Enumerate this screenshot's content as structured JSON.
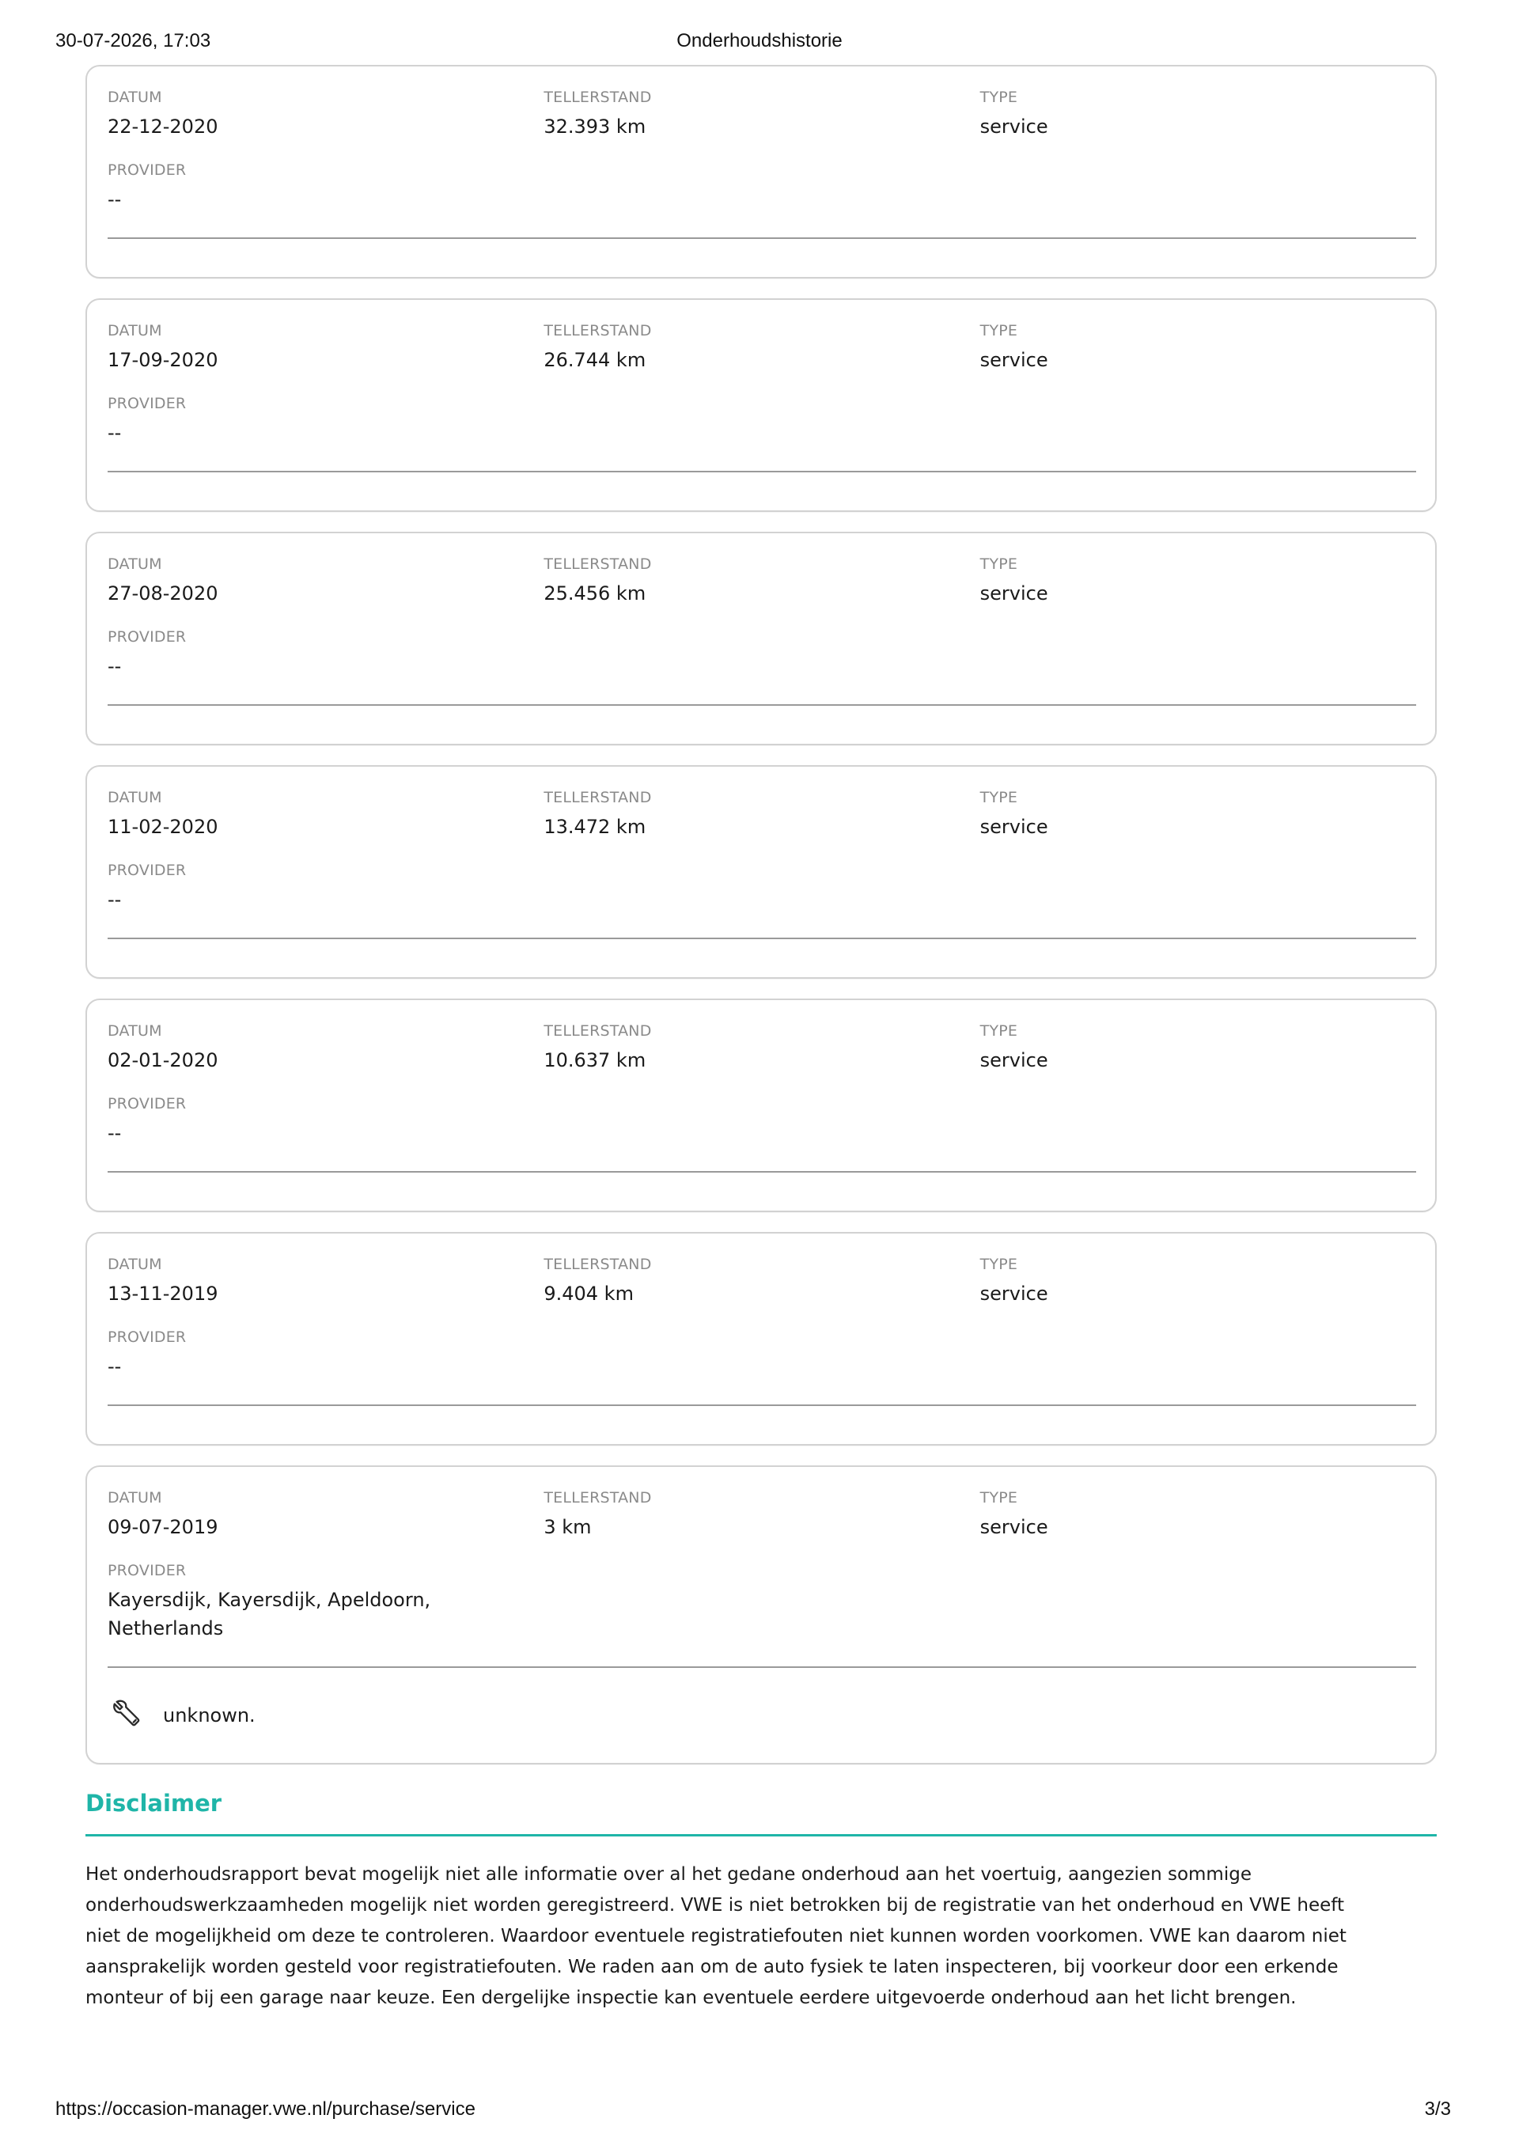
{
  "print_header": {
    "timestamp": "30-07-2026, 17:03",
    "title": "Onderhoudshistorie"
  },
  "labels": {
    "datum": "DATUM",
    "tellerstand": "TELLERSTAND",
    "type": "TYPE",
    "provider": "PROVIDER"
  },
  "records": [
    {
      "datum": "22-12-2020",
      "tellerstand": "32.393 km",
      "type": "service",
      "provider": "--"
    },
    {
      "datum": "17-09-2020",
      "tellerstand": "26.744 km",
      "type": "service",
      "provider": "--"
    },
    {
      "datum": "27-08-2020",
      "tellerstand": "25.456 km",
      "type": "service",
      "provider": "--"
    },
    {
      "datum": "11-02-2020",
      "tellerstand": "13.472 km",
      "type": "service",
      "provider": "--"
    },
    {
      "datum": "02-01-2020",
      "tellerstand": "10.637 km",
      "type": "service",
      "provider": "--"
    },
    {
      "datum": "13-11-2019",
      "tellerstand": "9.404 km",
      "type": "service",
      "provider": "--"
    },
    {
      "datum": "09-07-2019",
      "tellerstand": "3 km",
      "type": "service",
      "provider_line1": "Kayersdijk, Kayersdijk, Apeldoorn,",
      "provider_line2": "Netherlands",
      "tool_icon": "wrench-icon",
      "tool_text": "unknown."
    }
  ],
  "disclaimer": {
    "title": "Disclaimer",
    "lines": [
      "Het onderhoudsrapport bevat mogelijk niet alle informatie over al het gedane onderhoud aan het voertuig, aangezien sommige",
      "onderhoudswerkzaamheden mogelijk niet worden geregistreerd. VWE is niet betrokken bij de registratie van het onderhoud en VWE heeft",
      "niet de mogelijkheid om deze te controleren. Waardoor eventuele registratiefouten niet kunnen worden voorkomen. VWE kan daarom niet",
      "aansprakelijk worden gesteld voor registratiefouten. We raden aan om de auto fysiek te laten inspecteren, bij voorkeur door een erkende",
      "monteur of bij een garage naar keuze. Een dergelijke inspectie kan eventuele eerdere uitgevoerde onderhoud aan het licht brengen."
    ]
  },
  "print_footer": {
    "url": "https://occasion-manager.vwe.nl/purchase/service",
    "pages": "3/3"
  },
  "colors": {
    "accent": "#1fb5a8",
    "card_border": "#d2d2d2",
    "label": "#8a8a8a"
  }
}
